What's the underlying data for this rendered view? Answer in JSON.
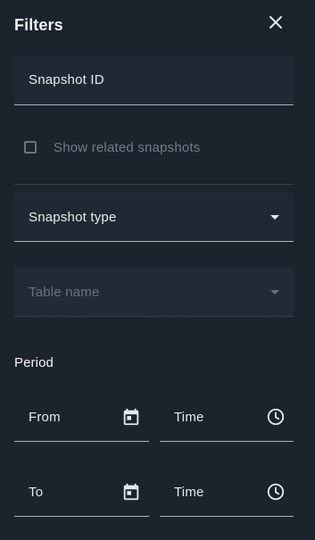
{
  "header": {
    "title": "Filters",
    "close_icon": "close-icon"
  },
  "filters": {
    "snapshot_id": {
      "label": "Snapshot ID",
      "value": ""
    },
    "related": {
      "label": "Show related snapshots",
      "checked": false,
      "disabled": true
    },
    "snapshot_type": {
      "label": "Snapshot type",
      "value": "",
      "icon": "arrow-drop-down-icon"
    },
    "table_name": {
      "label": "Table name",
      "value": "",
      "disabled": true,
      "icon": "arrow-drop-down-icon"
    }
  },
  "period": {
    "label": "Period",
    "from_date": {
      "label": "From",
      "icon": "calendar-icon"
    },
    "from_time": {
      "label": "Time",
      "icon": "clock-icon"
    },
    "to_date": {
      "label": "To",
      "icon": "calendar-icon"
    },
    "to_time": {
      "label": "Time",
      "icon": "clock-icon"
    }
  },
  "colors": {
    "background": "#1b232d",
    "field_fill": "#202933",
    "text": "#e5e9ed",
    "muted_text": "#737d87",
    "underline": "#aab3bc"
  }
}
